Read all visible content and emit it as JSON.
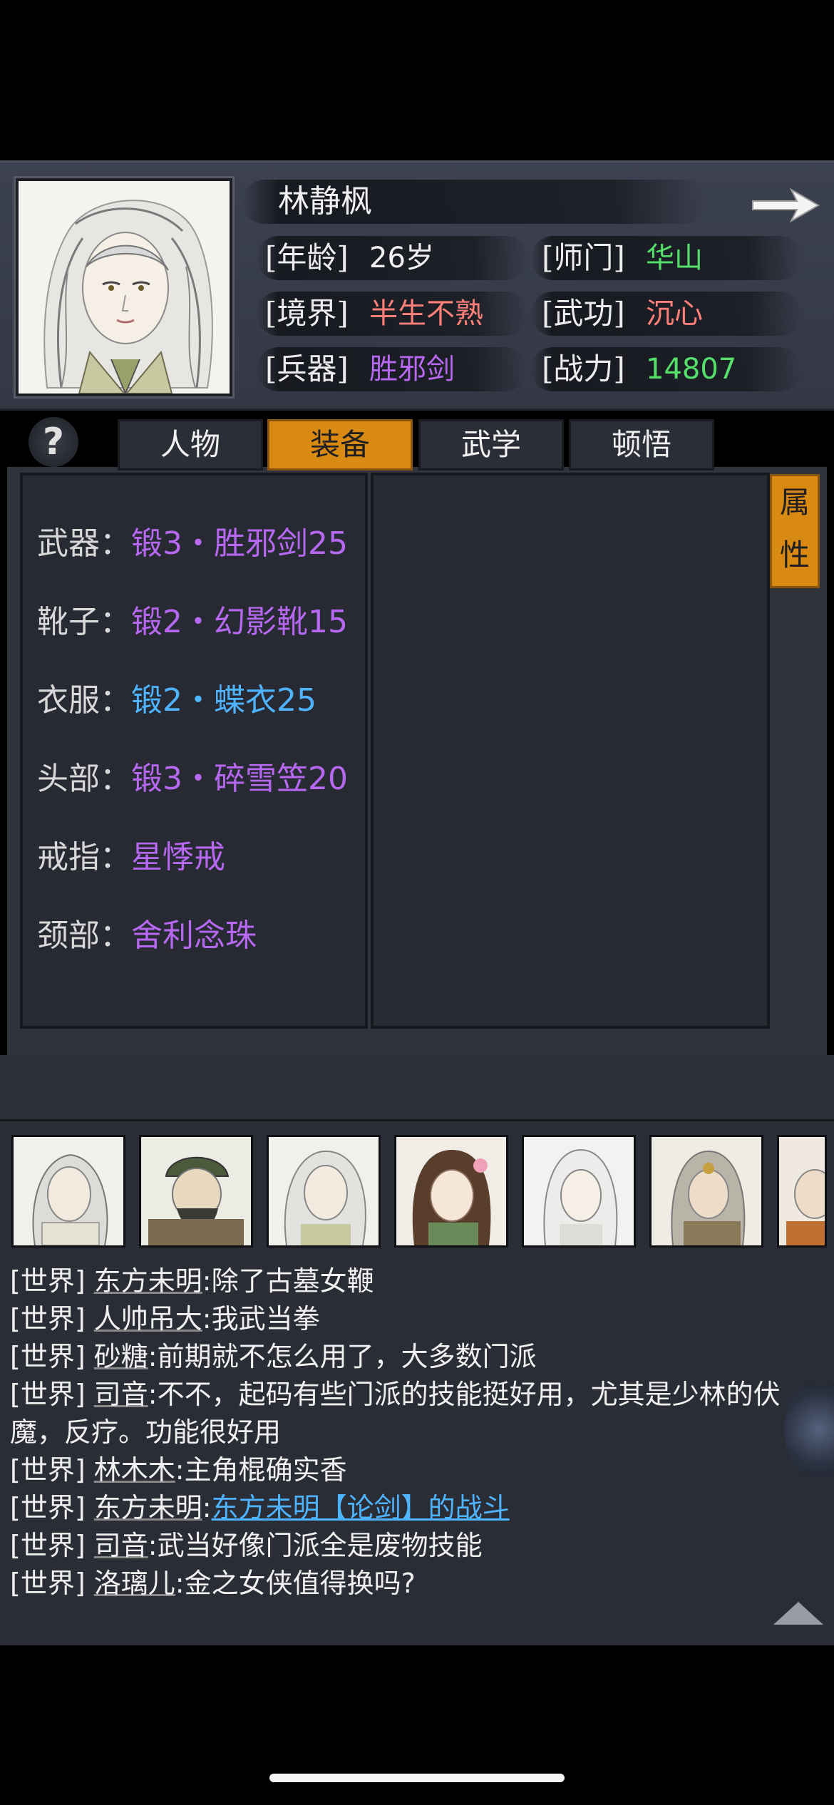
{
  "character": {
    "name": "林静枫",
    "stats": [
      {
        "label": "[年龄]",
        "value": "26岁",
        "color": "#f2f2f2"
      },
      {
        "label": "[师门]",
        "value": "华山",
        "color": "#54e06a"
      },
      {
        "label": "[境界]",
        "value": "半生不熟",
        "color": "#ff7f79"
      },
      {
        "label": "[武功]",
        "value": "沉心",
        "color": "#ff7f79"
      },
      {
        "label": "[兵器]",
        "value": "胜邪剑",
        "color": "#b668f0"
      },
      {
        "label": "[战力]",
        "value": "14807",
        "color": "#54e06a"
      }
    ]
  },
  "tabs": {
    "help": "?",
    "items": [
      "人物",
      "装备",
      "武学",
      "顿悟"
    ],
    "active": "装备"
  },
  "attr_tab": {
    "line1": "属",
    "line2": "性"
  },
  "equipment": [
    {
      "label": "武器：",
      "value": "锻3・胜邪剑25",
      "color": "#b668f0"
    },
    {
      "label": "靴子：",
      "value": "锻2・幻影靴15",
      "color": "#b668f0"
    },
    {
      "label": "衣服：",
      "value": "锻2・蝶衣25",
      "color": "#4fb4ff"
    },
    {
      "label": "头部：",
      "value": "锻3・碎雪笠20",
      "color": "#b668f0"
    },
    {
      "label": "戒指：",
      "value": "星悸戒",
      "color": "#b668f0"
    },
    {
      "label": "颈部：",
      "value": "舍利念珠",
      "color": "#b668f0"
    }
  ],
  "chat": {
    "lines": [
      {
        "channel": "[世界]",
        "name": "东方未明",
        "text": ":除了古墓女鞭"
      },
      {
        "channel": "[世界]",
        "name": "人帅吊大",
        "text": ":我武当拳"
      },
      {
        "channel": "[世界]",
        "name": "砂糖",
        "text": ":前期就不怎么用了，大多数门派"
      },
      {
        "channel": "[世界]",
        "name": "司音",
        "text": ":不不，起码有些门派的技能挺好用，尤其是少林的伏"
      },
      {
        "channel": "",
        "name": "",
        "text": "魔，反疗。功能很好用"
      },
      {
        "channel": "[世界]",
        "name": "林木木",
        "text": ":主角棍确实香"
      },
      {
        "channel": "[世界]",
        "name": "东方未明",
        "text": ":",
        "link": "东方未明【论剑】的战斗"
      },
      {
        "channel": "[世界]",
        "name": "司音",
        "text": ":武当好像门派全是废物技能"
      },
      {
        "channel": "[世界]",
        "name": "洛璃儿",
        "text": ":金之女侠值得换吗?"
      }
    ]
  }
}
